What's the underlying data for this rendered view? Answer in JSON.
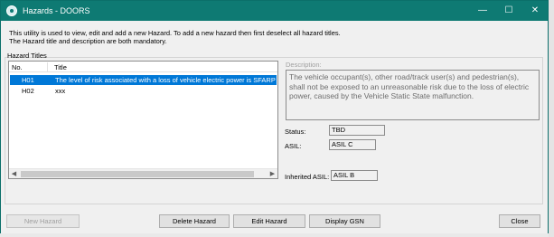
{
  "window": {
    "title": "Hazards - DOORS",
    "controls": {
      "minimize": "—",
      "maximize": "☐",
      "close": "✕"
    }
  },
  "info": {
    "line1": "This utility is used to view, edit and add a new Hazard. To add a new hazard then first deselect all hazard titles.",
    "line2": "The Hazard title and description are both mandatory."
  },
  "hazard_titles": {
    "group_label": "Hazard Titles",
    "columns": {
      "no": "No.",
      "title": "Title"
    },
    "rows": [
      {
        "no": "H01",
        "title": "The level of risk associated with a loss of vehicle electric power is SFARP",
        "selected": true
      },
      {
        "no": "H02",
        "title": "xxx",
        "selected": false
      }
    ]
  },
  "description": {
    "label": "Description:",
    "value": "The vehicle occupant(s), other road/track user(s) and pedestrian(s), shall not be exposed to an unreasonable risk due to the loss of electric power, caused by the Vehicle Static State malfunction."
  },
  "fields": {
    "status_label": "Status:",
    "status_value": "TBD",
    "asil_label": "ASIL:",
    "asil_value": "ASIL C",
    "inherited_asil_label": "Inherited ASIL:",
    "inherited_asil_value": "ASIL B"
  },
  "buttons": {
    "new_hazard": "New Hazard",
    "delete_hazard": "Delete Hazard",
    "edit_hazard": "Edit Hazard",
    "display_gsn": "Display GSN",
    "close": "Close"
  }
}
